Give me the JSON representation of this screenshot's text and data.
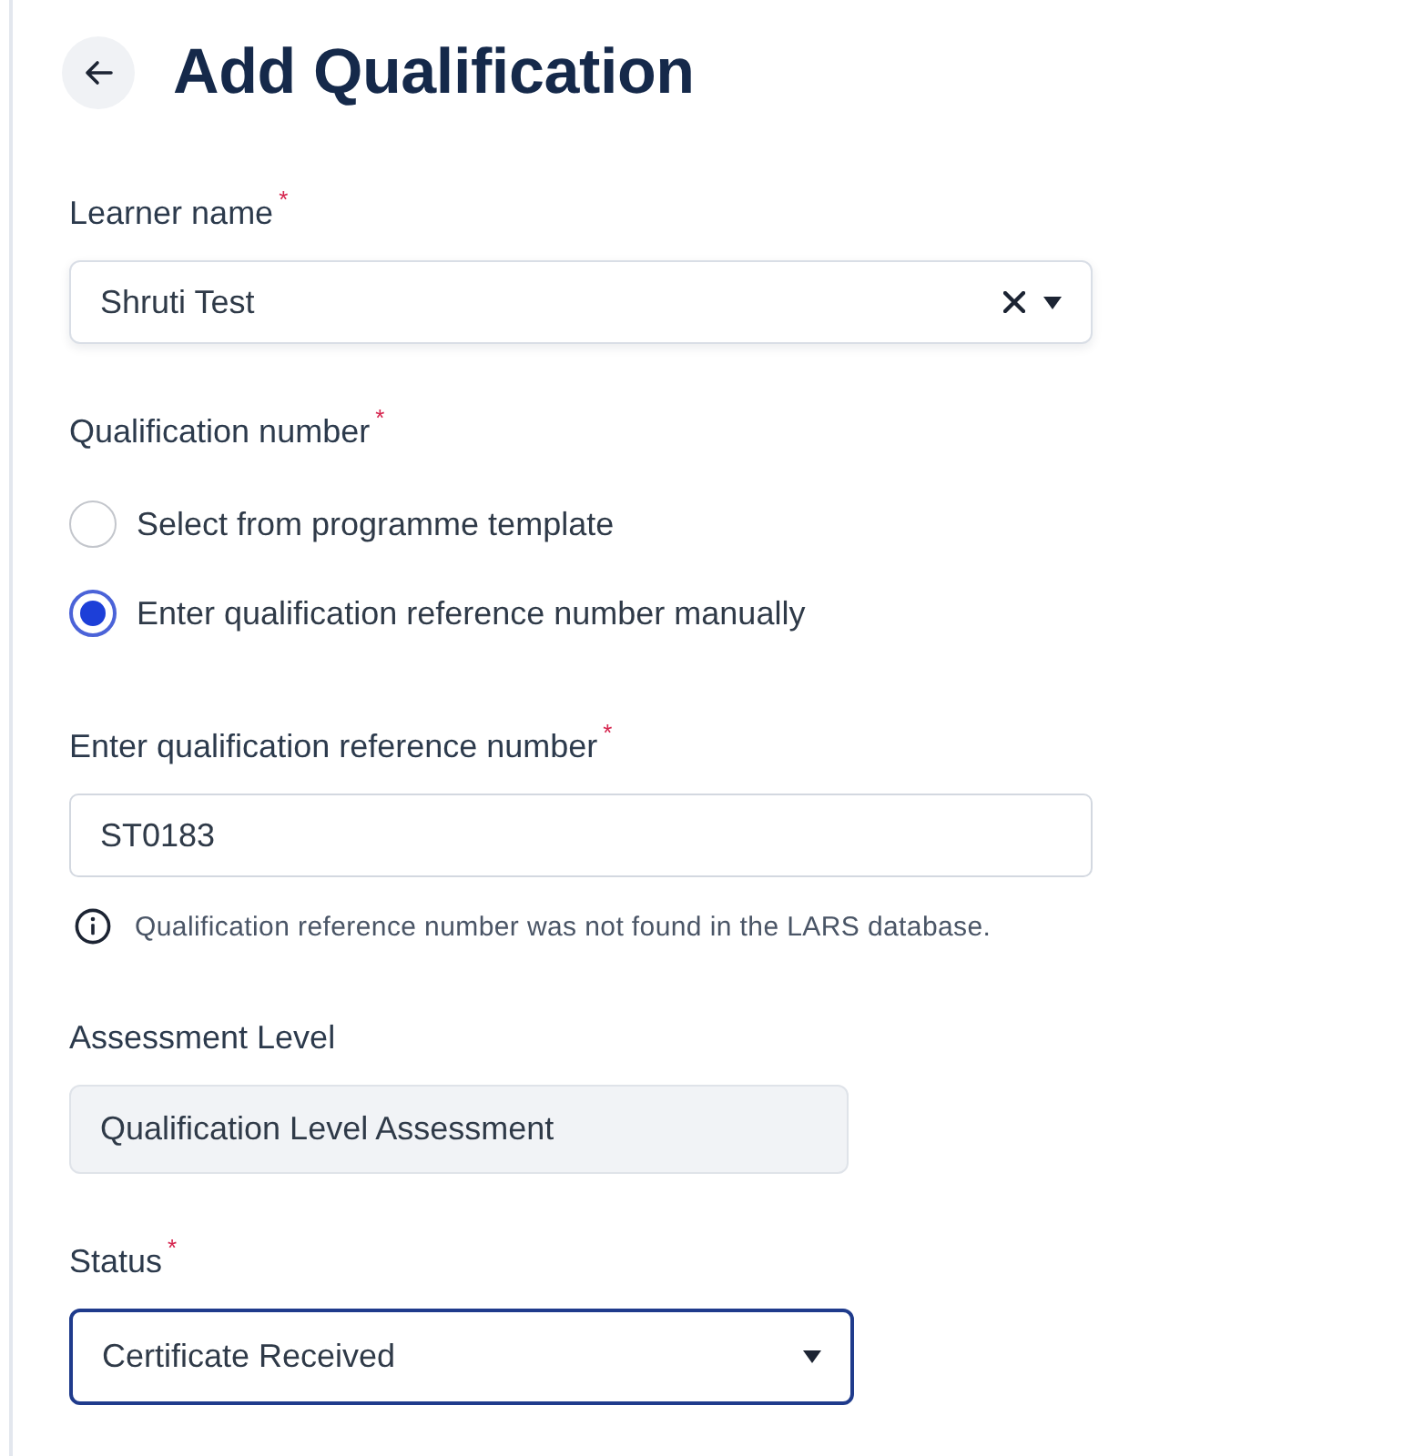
{
  "header": {
    "title": "Add Qualification"
  },
  "fields": [
    {
      "kind": "select",
      "label": "Learner name",
      "required_mark": "*",
      "value": "Shruti Test",
      "clearable": true,
      "focused": false
    },
    {
      "kind": "radio_group",
      "label": "Qualification number",
      "required_mark": "*",
      "options": [
        {
          "label": "Select from programme template",
          "selected": false
        },
        {
          "label": "Enter qualification reference number manually",
          "selected": true
        }
      ]
    },
    {
      "kind": "text",
      "label": "Enter qualification reference number",
      "required_mark": "*",
      "value": "ST0183",
      "hint": "Qualification reference number was not found in the LARS database."
    },
    {
      "kind": "readonly",
      "label": "Assessment Level",
      "value": "Qualification Level Assessment"
    },
    {
      "kind": "select",
      "label": "Status",
      "required_mark": "*",
      "value": "Certificate Received",
      "clearable": false,
      "focused": true
    }
  ]
}
